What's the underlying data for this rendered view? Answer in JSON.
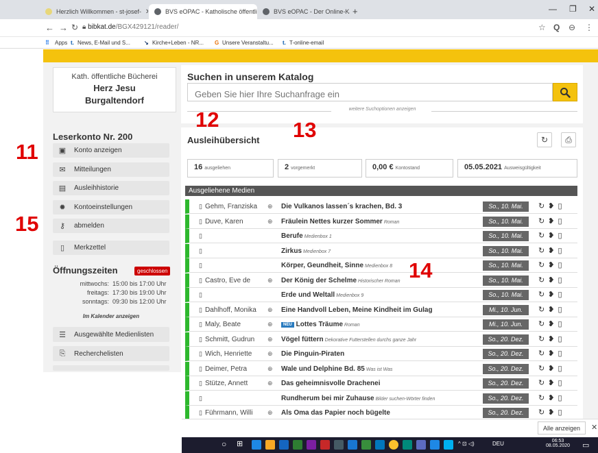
{
  "browser": {
    "tabs": [
      {
        "label": "Herzlich Willkommen - st-josef-"
      },
      {
        "label": "BVS eOPAC - Katholische öffentli"
      },
      {
        "label": "BVS eOPAC - Der Online-Katalog"
      }
    ],
    "url_host": "bibkat.de",
    "url_path": "/BGX429121/reader/",
    "bookmarks": [
      "Apps",
      "News, E-Mail und S...",
      "Kirche+Leben - NR...",
      "Unsere Veranstaltu...",
      "T-online-email"
    ]
  },
  "library": {
    "line1": "Kath. öffentliche Bücherei",
    "line2": "Herz Jesu",
    "line3": "Burgaltendorf"
  },
  "account": {
    "title": "Leserkonto Nr. 200",
    "menu": [
      {
        "label": "Konto anzeigen",
        "icon": "id-card-icon"
      },
      {
        "label": "Mitteilungen",
        "icon": "envelope-icon"
      },
      {
        "label": "Ausleihhistorie",
        "icon": "history-list-icon"
      },
      {
        "label": "Kontoeinstellungen",
        "icon": "gear-icon"
      },
      {
        "label": "abmelden",
        "icon": "key-icon"
      }
    ],
    "merkzettel": "Merkzettel"
  },
  "hours": {
    "title": "Öffnungszeiten",
    "badge": "geschlossen",
    "rows": [
      {
        "day": "mittwochs:",
        "time": "15:00 bis 17:00 Uhr"
      },
      {
        "day": "freitags:",
        "time": "17:30 bis 19:00 Uhr"
      },
      {
        "day": "sonntags:",
        "time": "09:30 bis 12:00 Uhr"
      }
    ],
    "calendar_link": "Im Kalender anzeigen"
  },
  "lists": {
    "item1": "Ausgewählte Medienlisten",
    "item2": "Recherchelisten"
  },
  "search": {
    "title": "Suchen in unserem Katalog",
    "placeholder": "Geben Sie hier Ihre Suchanfrage ein",
    "options_link": "weitere Suchoptionen anzeigen"
  },
  "overview": {
    "title": "Ausleihübersicht",
    "stats": [
      {
        "value": "16",
        "label": "ausgeliehen"
      },
      {
        "value": "2",
        "label": "vorgemerkt"
      },
      {
        "value": "0,00 €",
        "label": "Kontostand"
      },
      {
        "value": "05.05.2021",
        "label": "Ausweisgültigkeit"
      }
    ],
    "section": "Ausgeliehene Medien",
    "items": [
      {
        "author": "Gehm, Franziska",
        "title": "Die Vulkanos lassen´s krachen, Bd. 3",
        "sub": "",
        "due": "So., 10. Mai.",
        "neu": false,
        "mt": true
      },
      {
        "author": "Duve, Karen",
        "title": "Fräulein Nettes kurzer Sommer",
        "sub": "Roman",
        "due": "So., 10. Mai.",
        "neu": false,
        "mt": true
      },
      {
        "author": "",
        "title": "Berufe",
        "sub": "Medienbox 1",
        "due": "So., 10. Mai.",
        "neu": false,
        "mt": false
      },
      {
        "author": "",
        "title": "Zirkus",
        "sub": "Medienbox 7",
        "due": "So., 10. Mai.",
        "neu": false,
        "mt": false
      },
      {
        "author": "",
        "title": "Körper, Geundheit, Sinne",
        "sub": "Medienbox 8",
        "due": "So., 10. Mai.",
        "neu": false,
        "mt": false
      },
      {
        "author": "Castro, Eve de",
        "title": "Der König der Schelme",
        "sub": "Historischer Roman",
        "due": "So., 10. Mai.",
        "neu": false,
        "mt": true
      },
      {
        "author": "",
        "title": "Erde und Weltall",
        "sub": "Medienbox 9",
        "due": "So., 10. Mai.",
        "neu": false,
        "mt": false
      },
      {
        "author": "Dahlhoff, Monika",
        "title": "Eine Handvoll Leben, Meine Kindheit im Gulag",
        "sub": "",
        "due": "Mi., 10. Jun.",
        "neu": false,
        "mt": true
      },
      {
        "author": "Maly, Beate",
        "title": "Lottes Träume",
        "sub": "Roman",
        "due": "Mi., 10. Jun.",
        "neu": true,
        "mt": true
      },
      {
        "author": "Schmitt, Gudrun",
        "title": "Vögel füttern",
        "sub": "Dekorative Futterstellen durchs ganze Jahr",
        "due": "So., 20. Dez.",
        "neu": false,
        "mt": true
      },
      {
        "author": "Wich, Henriette",
        "title": "Die Pinguin-Piraten",
        "sub": "",
        "due": "So., 20. Dez.",
        "neu": false,
        "mt": true
      },
      {
        "author": "Deimer, Petra",
        "title": "Wale und Delphine Bd. 85",
        "sub": "Was ist Was",
        "due": "So., 20. Dez.",
        "neu": false,
        "mt": true
      },
      {
        "author": "Stütze, Annett",
        "title": "Das geheimnisvolle Drachenei",
        "sub": "",
        "due": "So., 20. Dez.",
        "neu": false,
        "mt": true
      },
      {
        "author": "",
        "title": "Rundherum bei mir Zuhause",
        "sub": "Bilder suchen-Wörter finden",
        "due": "So., 20. Dez.",
        "neu": false,
        "mt": false
      },
      {
        "author": "Führmann, Willi",
        "title": "Als Oma das Papier noch bügelte",
        "sub": "",
        "due": "So., 20. Dez.",
        "neu": false,
        "mt": true
      }
    ]
  },
  "annotations": [
    "11",
    "12",
    "13",
    "14",
    "15"
  ],
  "download_bar": {
    "show_all": "Alle anzeigen"
  },
  "taskbar": {
    "lang": "DEU",
    "time": "06:53",
    "date": "08.05.2020"
  },
  "colors": {
    "accent_yellow": "#f4c20d",
    "loan_green": "#2eb82e",
    "closed_red": "#cc0000",
    "annotation_red": "#e00000"
  }
}
